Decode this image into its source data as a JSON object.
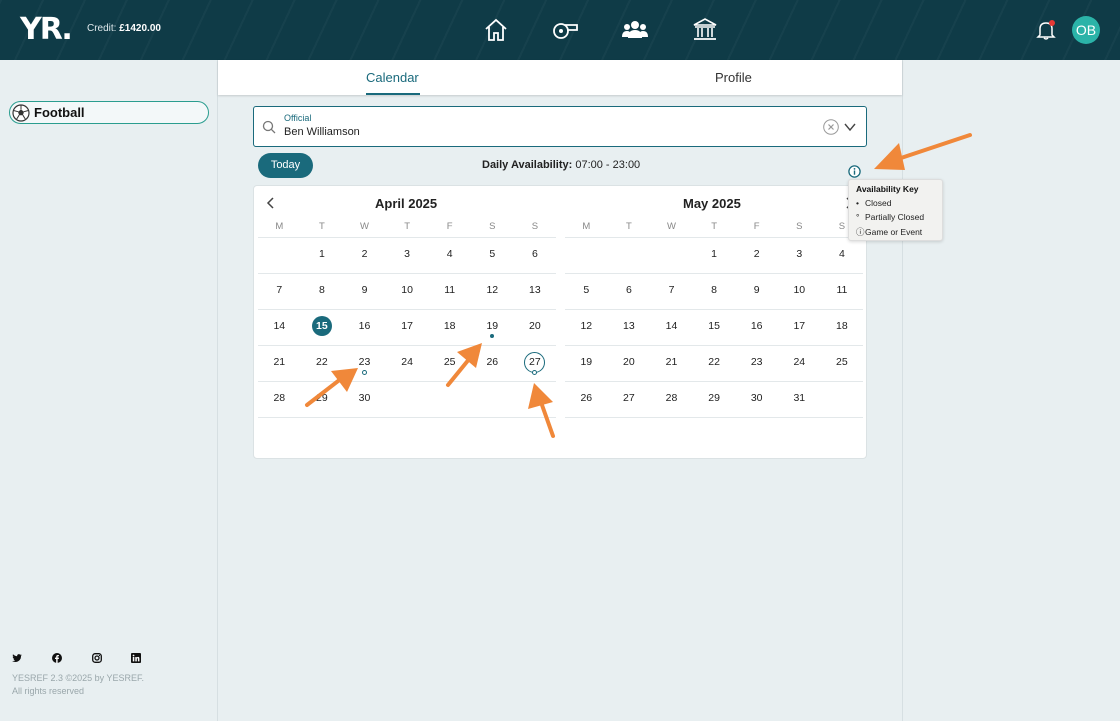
{
  "header": {
    "logo": "YR.",
    "credit_label": "Credit:",
    "credit_value": "£1420.00",
    "nav_icons": [
      "home-icon",
      "whistle-icon",
      "people-icon",
      "bank-icon"
    ],
    "avatar_initials": "OB"
  },
  "sidebar": {
    "sport": "Football",
    "social_icons": [
      "twitter-icon",
      "facebook-icon",
      "instagram-icon",
      "linkedin-icon"
    ],
    "footer_line1": "YESREF 2.3 ©2025 by YESREF.",
    "footer_line2": "All rights reserved"
  },
  "tabs": [
    {
      "label": "Calendar",
      "active": true
    },
    {
      "label": "Profile",
      "active": false
    }
  ],
  "official_field": {
    "label": "Official",
    "value": "Ben Williamson"
  },
  "toolbar": {
    "today_label": "Today",
    "daily_label": "Daily Availability:",
    "daily_value": "07:00 - 23:00"
  },
  "availability_key": {
    "title": "Availability Key",
    "items": [
      "Closed",
      "Partially Closed",
      "Game or Event"
    ]
  },
  "calendar": {
    "weekdays": [
      "M",
      "T",
      "W",
      "T",
      "F",
      "S",
      "S"
    ],
    "months": [
      {
        "title": "April 2025",
        "weeks": [
          [
            "",
            "1",
            "2",
            "3",
            "4",
            "5",
            "6"
          ],
          [
            "7",
            "8",
            "9",
            "10",
            "11",
            "12",
            "13"
          ],
          [
            "14",
            "15",
            "16",
            "17",
            "18",
            "19",
            "20"
          ],
          [
            "21",
            "22",
            "23",
            "24",
            "25",
            "26",
            "27"
          ],
          [
            "28",
            "29",
            "30",
            "",
            "",
            "",
            ""
          ]
        ],
        "today": "15",
        "closed": [
          "19"
        ],
        "partially_closed": [
          "23",
          "27"
        ],
        "game_or_event": [
          "27"
        ]
      },
      {
        "title": "May 2025",
        "weeks": [
          [
            "",
            "",
            "",
            "1",
            "2",
            "3",
            "4"
          ],
          [
            "5",
            "6",
            "7",
            "8",
            "9",
            "10",
            "11"
          ],
          [
            "12",
            "13",
            "14",
            "15",
            "16",
            "17",
            "18"
          ],
          [
            "19",
            "20",
            "21",
            "22",
            "23",
            "24",
            "25"
          ],
          [
            "26",
            "27",
            "28",
            "29",
            "30",
            "31",
            ""
          ]
        ],
        "today": "",
        "closed": [],
        "partially_closed": [],
        "game_or_event": []
      }
    ]
  },
  "colors": {
    "header_bg": "#0f3b47",
    "accent": "#1a6a7c",
    "avatar": "#2bb3a8",
    "annotation_arrow": "#f0883a"
  }
}
